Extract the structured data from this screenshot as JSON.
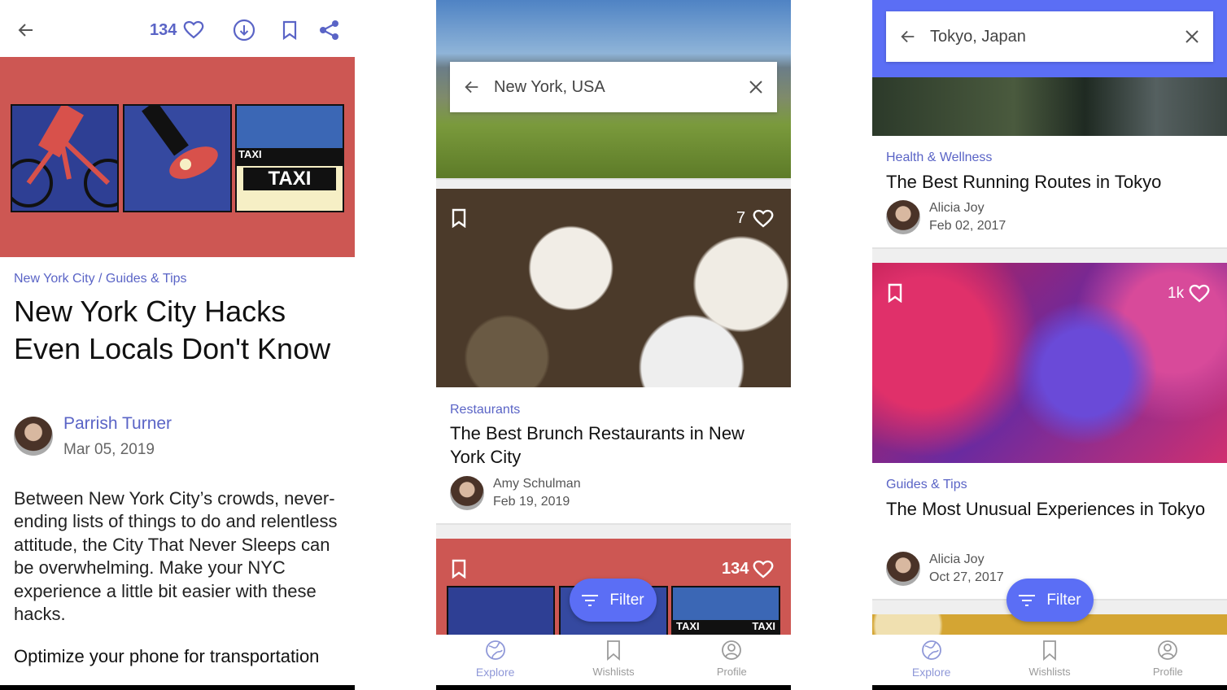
{
  "colors": {
    "accent": "#5b6ef5",
    "link": "#5a64c6",
    "card_red": "#cd5753"
  },
  "article": {
    "like_count": "134",
    "icons": [
      "back-arrow-icon",
      "heart-icon",
      "download-icon",
      "bookmark-icon",
      "share-icon"
    ],
    "category": "New York City / Guides & Tips",
    "title": "New York City Hacks Even Locals Don't Know",
    "author": "Parrish Turner",
    "date": "Mar 05, 2019",
    "body": "Between New York City’s crowds, never-ending lists of things to do and relentless attitude, the City That Never Sleeps can be overwhelming. Make your NYC experience a little bit easier with these hacks.",
    "subheading": "Optimize your phone for transportation"
  },
  "nyc": {
    "search_value": "New York, USA",
    "card1": {
      "likes": "7",
      "category": "Restaurants",
      "title": "The Best Brunch Restaurants in New York City",
      "author": "Amy Schulman",
      "date": "Feb 19, 2019"
    },
    "card2": {
      "likes": "134",
      "taxi1": "TAXI",
      "taxi2": "TAXI"
    },
    "filter_label": "Filter"
  },
  "tokyo": {
    "search_value": "Tokyo, Japan",
    "card1": {
      "category": "Health & Wellness",
      "title": "The Best Running Routes in Tokyo",
      "author": "Alicia Joy",
      "date": "Feb 02, 2017"
    },
    "card2": {
      "likes": "1k",
      "category": "Guides & Tips",
      "title": "The Most Unusual Experiences in Tokyo",
      "author": "Alicia Joy",
      "date": "Oct 27, 2017"
    },
    "filter_label": "Filter"
  },
  "nav": {
    "explore": "Explore",
    "wishlists": "Wishlists",
    "profile": "Profile"
  },
  "illustration": {
    "taxi_big": "TAXI",
    "taxi_small": "TAXI"
  }
}
